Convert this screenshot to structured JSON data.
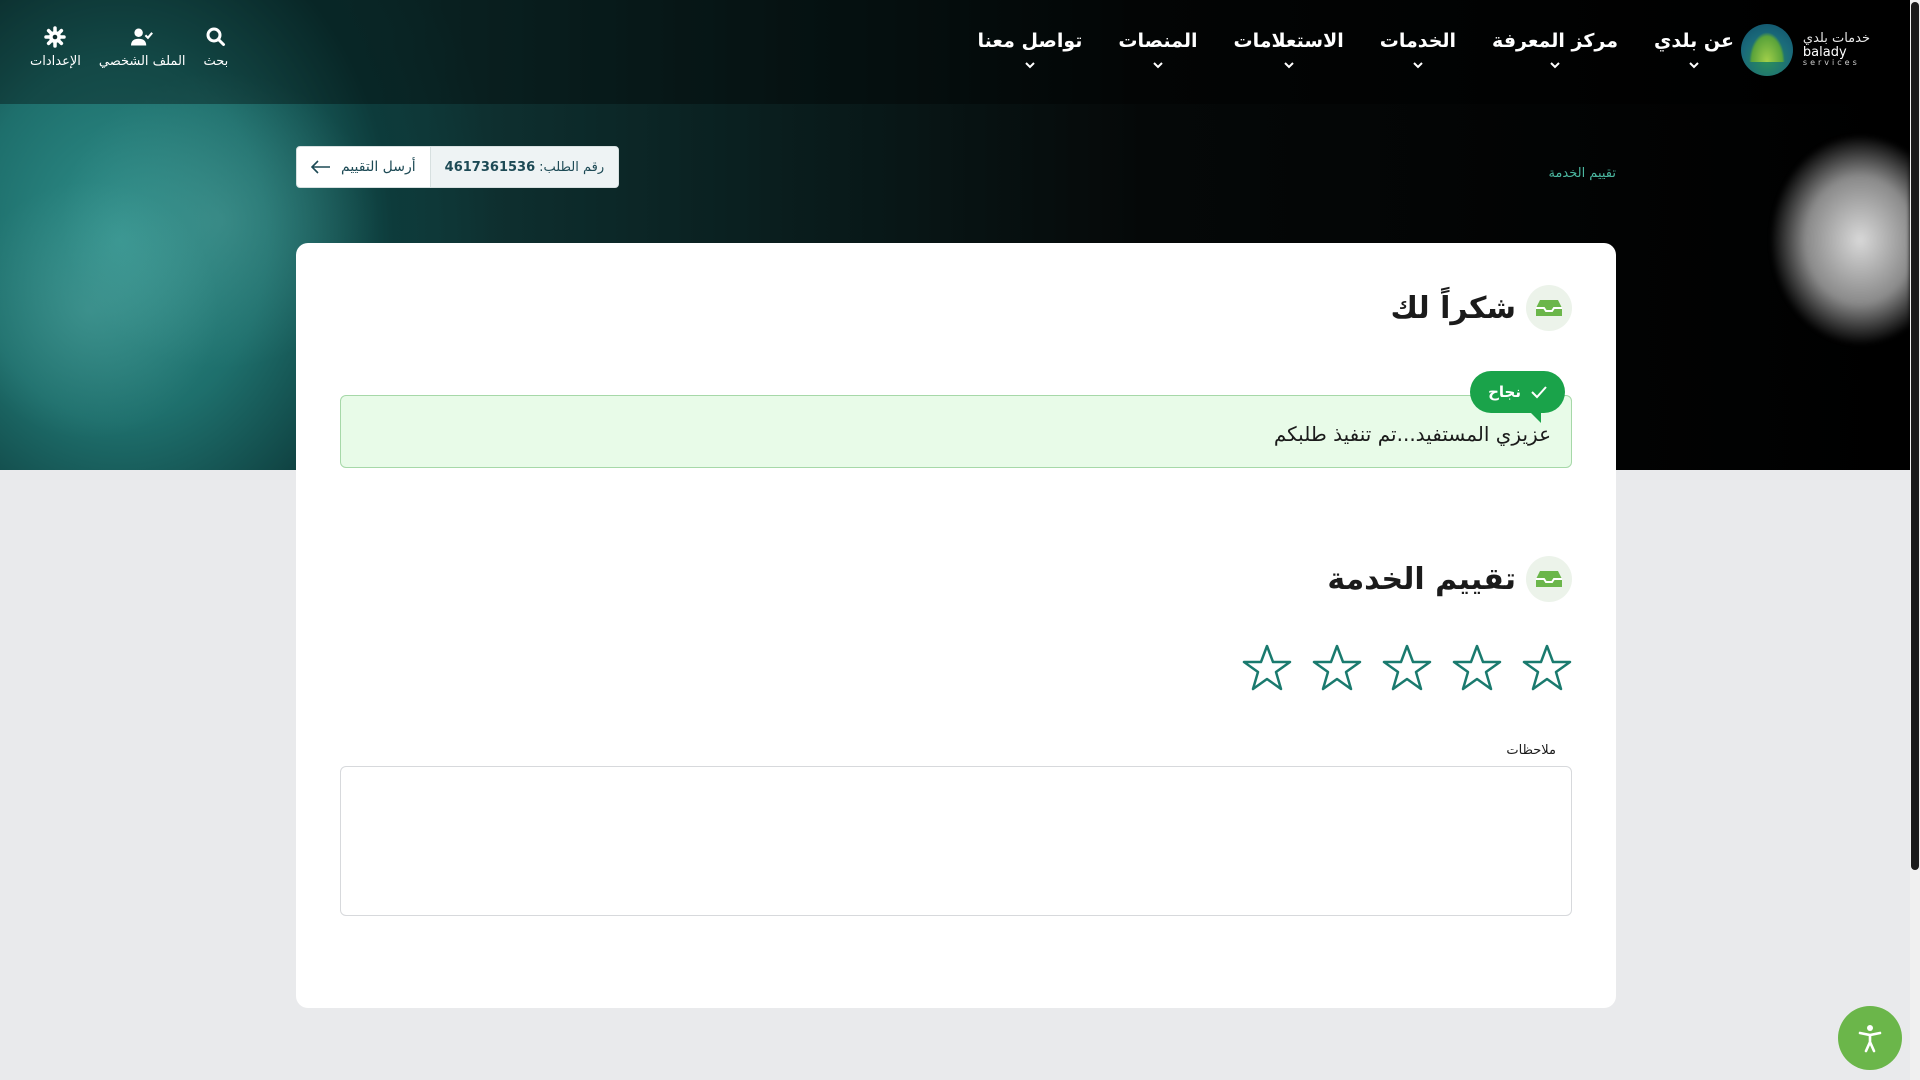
{
  "nav": {
    "logo": {
      "arabic": "خدمات بلدي",
      "english": "balady",
      "tagline": "services"
    },
    "menu": [
      {
        "label": "عن بلدي"
      },
      {
        "label": "مركز المعرفة"
      },
      {
        "label": "الخدمات"
      },
      {
        "label": "الاستعلامات"
      },
      {
        "label": "المنصات"
      },
      {
        "label": "تواصل معنا"
      }
    ],
    "utils": {
      "search": "بحث",
      "profile": "الملف الشخصي",
      "settings": "الإعدادات"
    }
  },
  "breadcrumb": "تقييم الخدمة",
  "request": {
    "number_label": "رقم الطلب:",
    "number_value": "4617361536",
    "send_label": "أرسل التقييم"
  },
  "thanks": {
    "title": "شكراً لك",
    "badge": "نجاح",
    "message": "عزيزي المستفيد...تم تنفيذ طلبكم"
  },
  "rating": {
    "title": "تقييم الخدمة",
    "stars_total": 5,
    "stars_selected": 0,
    "notes_label": "ملاحظات",
    "notes_value": ""
  },
  "colors": {
    "accent_teal": "#1a7a6e",
    "success_green": "#1aa34a",
    "alert_bg": "#e8fbe8",
    "a11y_green": "#6bb64a"
  }
}
